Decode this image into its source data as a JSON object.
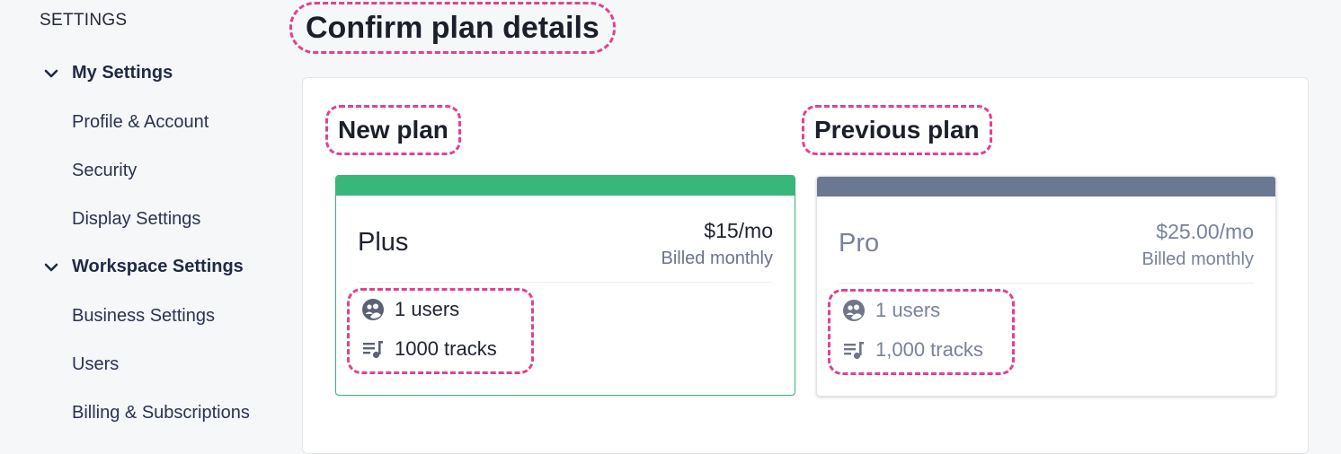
{
  "sidebar": {
    "heading": "SETTINGS",
    "groups": [
      {
        "label": "My Settings",
        "items": [
          "Profile & Account",
          "Security",
          "Display Settings"
        ]
      },
      {
        "label": "Workspace Settings",
        "items": [
          "Business Settings",
          "Users",
          "Billing & Subscriptions"
        ]
      }
    ]
  },
  "main": {
    "title": "Confirm plan details",
    "new_plan": {
      "heading": "New plan",
      "name": "Plus",
      "price": "$15/mo",
      "billing": "Billed monthly",
      "users": "1 users",
      "tracks": "1000 tracks",
      "accent_color": "#37b779"
    },
    "previous_plan": {
      "heading": "Previous plan",
      "name": "Pro",
      "price": "$25.00/mo",
      "billing": "Billed monthly",
      "users": "1 users",
      "tracks": "1,000 tracks",
      "accent_color": "#6b7891"
    }
  },
  "icons": {
    "expand": "chevron-down-icon",
    "users": "users-icon",
    "tracks": "playlist-music-icon"
  }
}
